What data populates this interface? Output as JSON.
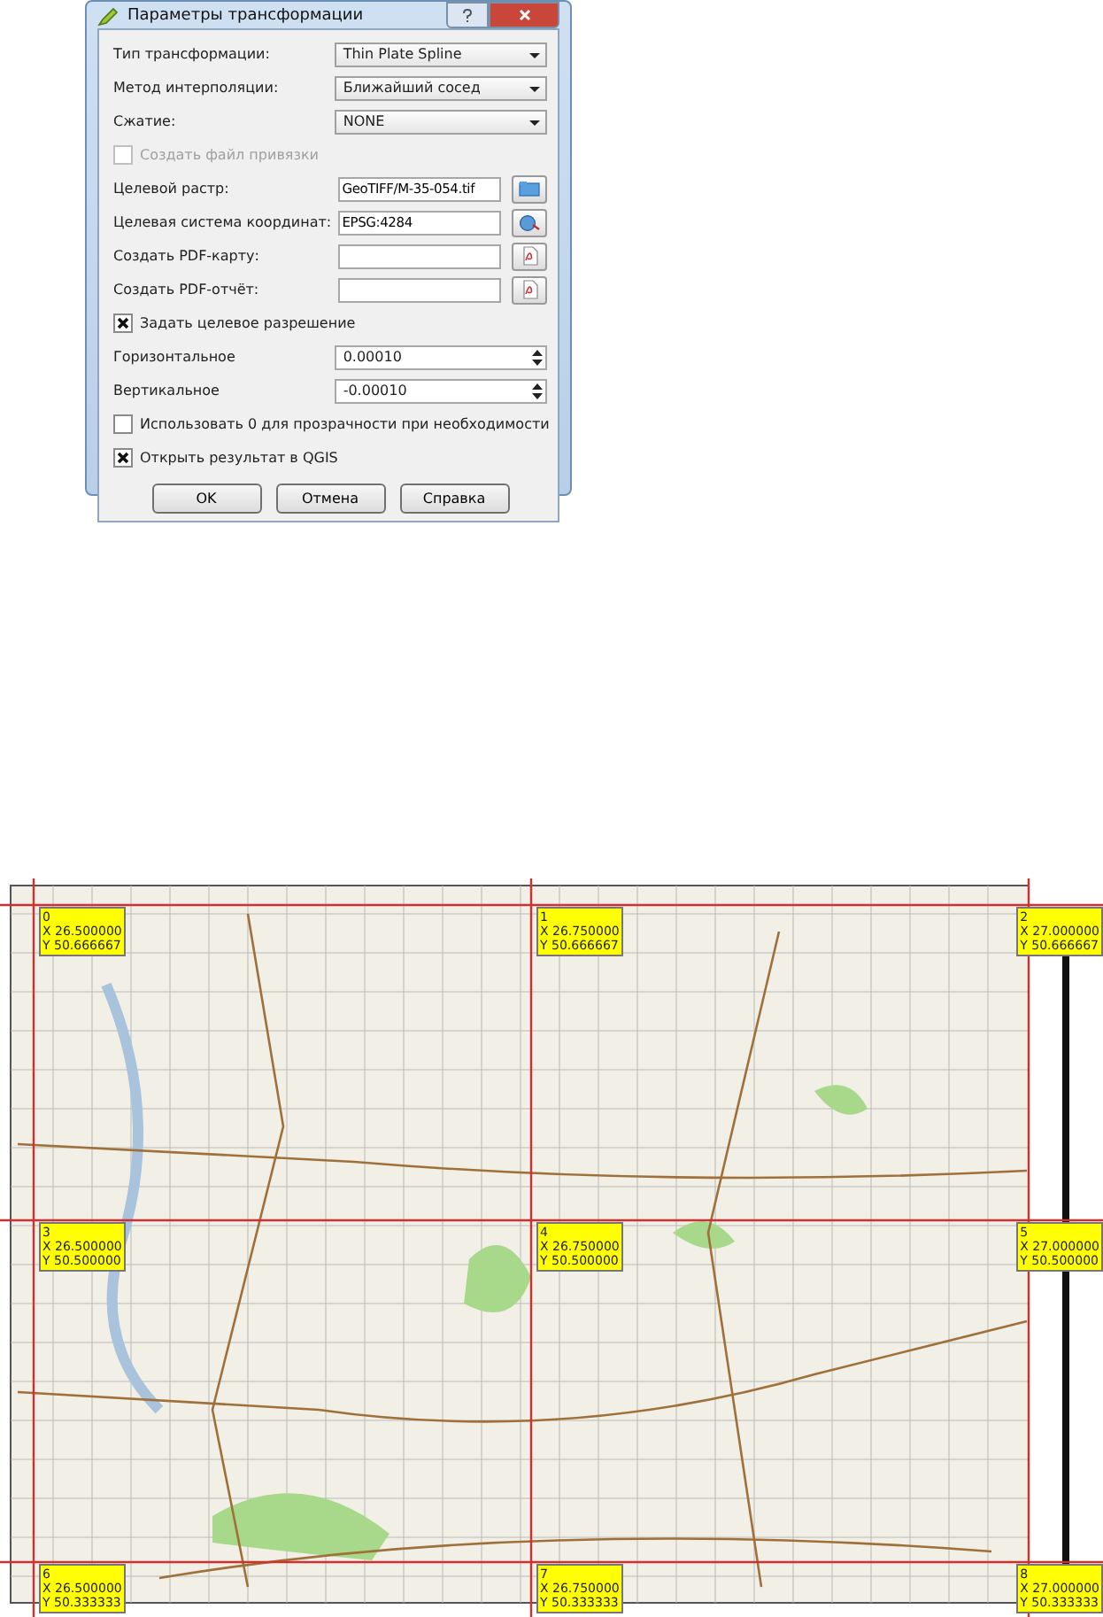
{
  "dialog": {
    "title": "Параметры трансформации",
    "rows": [
      {
        "kind": "combo",
        "label": "Тип трансформации:",
        "value": "Thin Plate Spline"
      },
      {
        "kind": "combo",
        "label": "Метод интерполяции:",
        "value": "Ближайший сосед"
      },
      {
        "kind": "combo",
        "label": "Сжатие:",
        "value": "NONE"
      },
      {
        "kind": "checkbox",
        "label": "Создать файл привязки",
        "checked": false,
        "disabled": true
      },
      {
        "kind": "file",
        "label": "Целевой растр:",
        "value": "GeoTIFF/M-35-054.tif"
      },
      {
        "kind": "file",
        "label": "Целевая система координат:",
        "value": "EPSG:4284"
      },
      {
        "kind": "file",
        "label": "Создать PDF-карту:"
      },
      {
        "kind": "file",
        "label": "Создать PDF-отчёт:"
      },
      {
        "kind": "checkbox",
        "label": "Задать целевое разрешение",
        "checked": true,
        "disabled": false
      },
      {
        "kind": "spin",
        "label": "Горизонтальное",
        "value": "0.00010"
      },
      {
        "kind": "spin",
        "label": "Вертикальное",
        "value": "-0.00010"
      },
      {
        "kind": "checkbox",
        "label": "Использовать 0 для прозрачности при необходимости",
        "checked": false,
        "disabled": false
      },
      {
        "kind": "checkbox",
        "label": "Открыть результат в QGIS",
        "checked": true,
        "disabled": false
      }
    ],
    "buttons": [
      "OK",
      "Отмена",
      "Справка"
    ]
  },
  "map": {
    "points": [
      {
        "number": "0",
        "x": "X 26.500000",
        "y": "Y 50.666667"
      },
      {
        "number": "1",
        "x": "X 26.750000",
        "y": "Y 50.666667"
      },
      {
        "number": "2",
        "x": "X 27.000000",
        "y": "Y 50.666667"
      },
      {
        "number": "3",
        "x": "X 26.500000",
        "y": "Y 50.500000"
      },
      {
        "number": "4",
        "x": "X 26.750000",
        "y": "Y 50.500000"
      },
      {
        "number": "5",
        "x": "X 27.000000",
        "y": "Y 50.500000"
      },
      {
        "number": "6",
        "x": "X 26.500000",
        "y": "Y 50.333333"
      },
      {
        "number": "7",
        "x": "X 26.750000",
        "y": "Y 50.333333"
      },
      {
        "number": "8",
        "x": "X 27.000000",
        "y": "Y 50.333333"
      }
    ]
  }
}
